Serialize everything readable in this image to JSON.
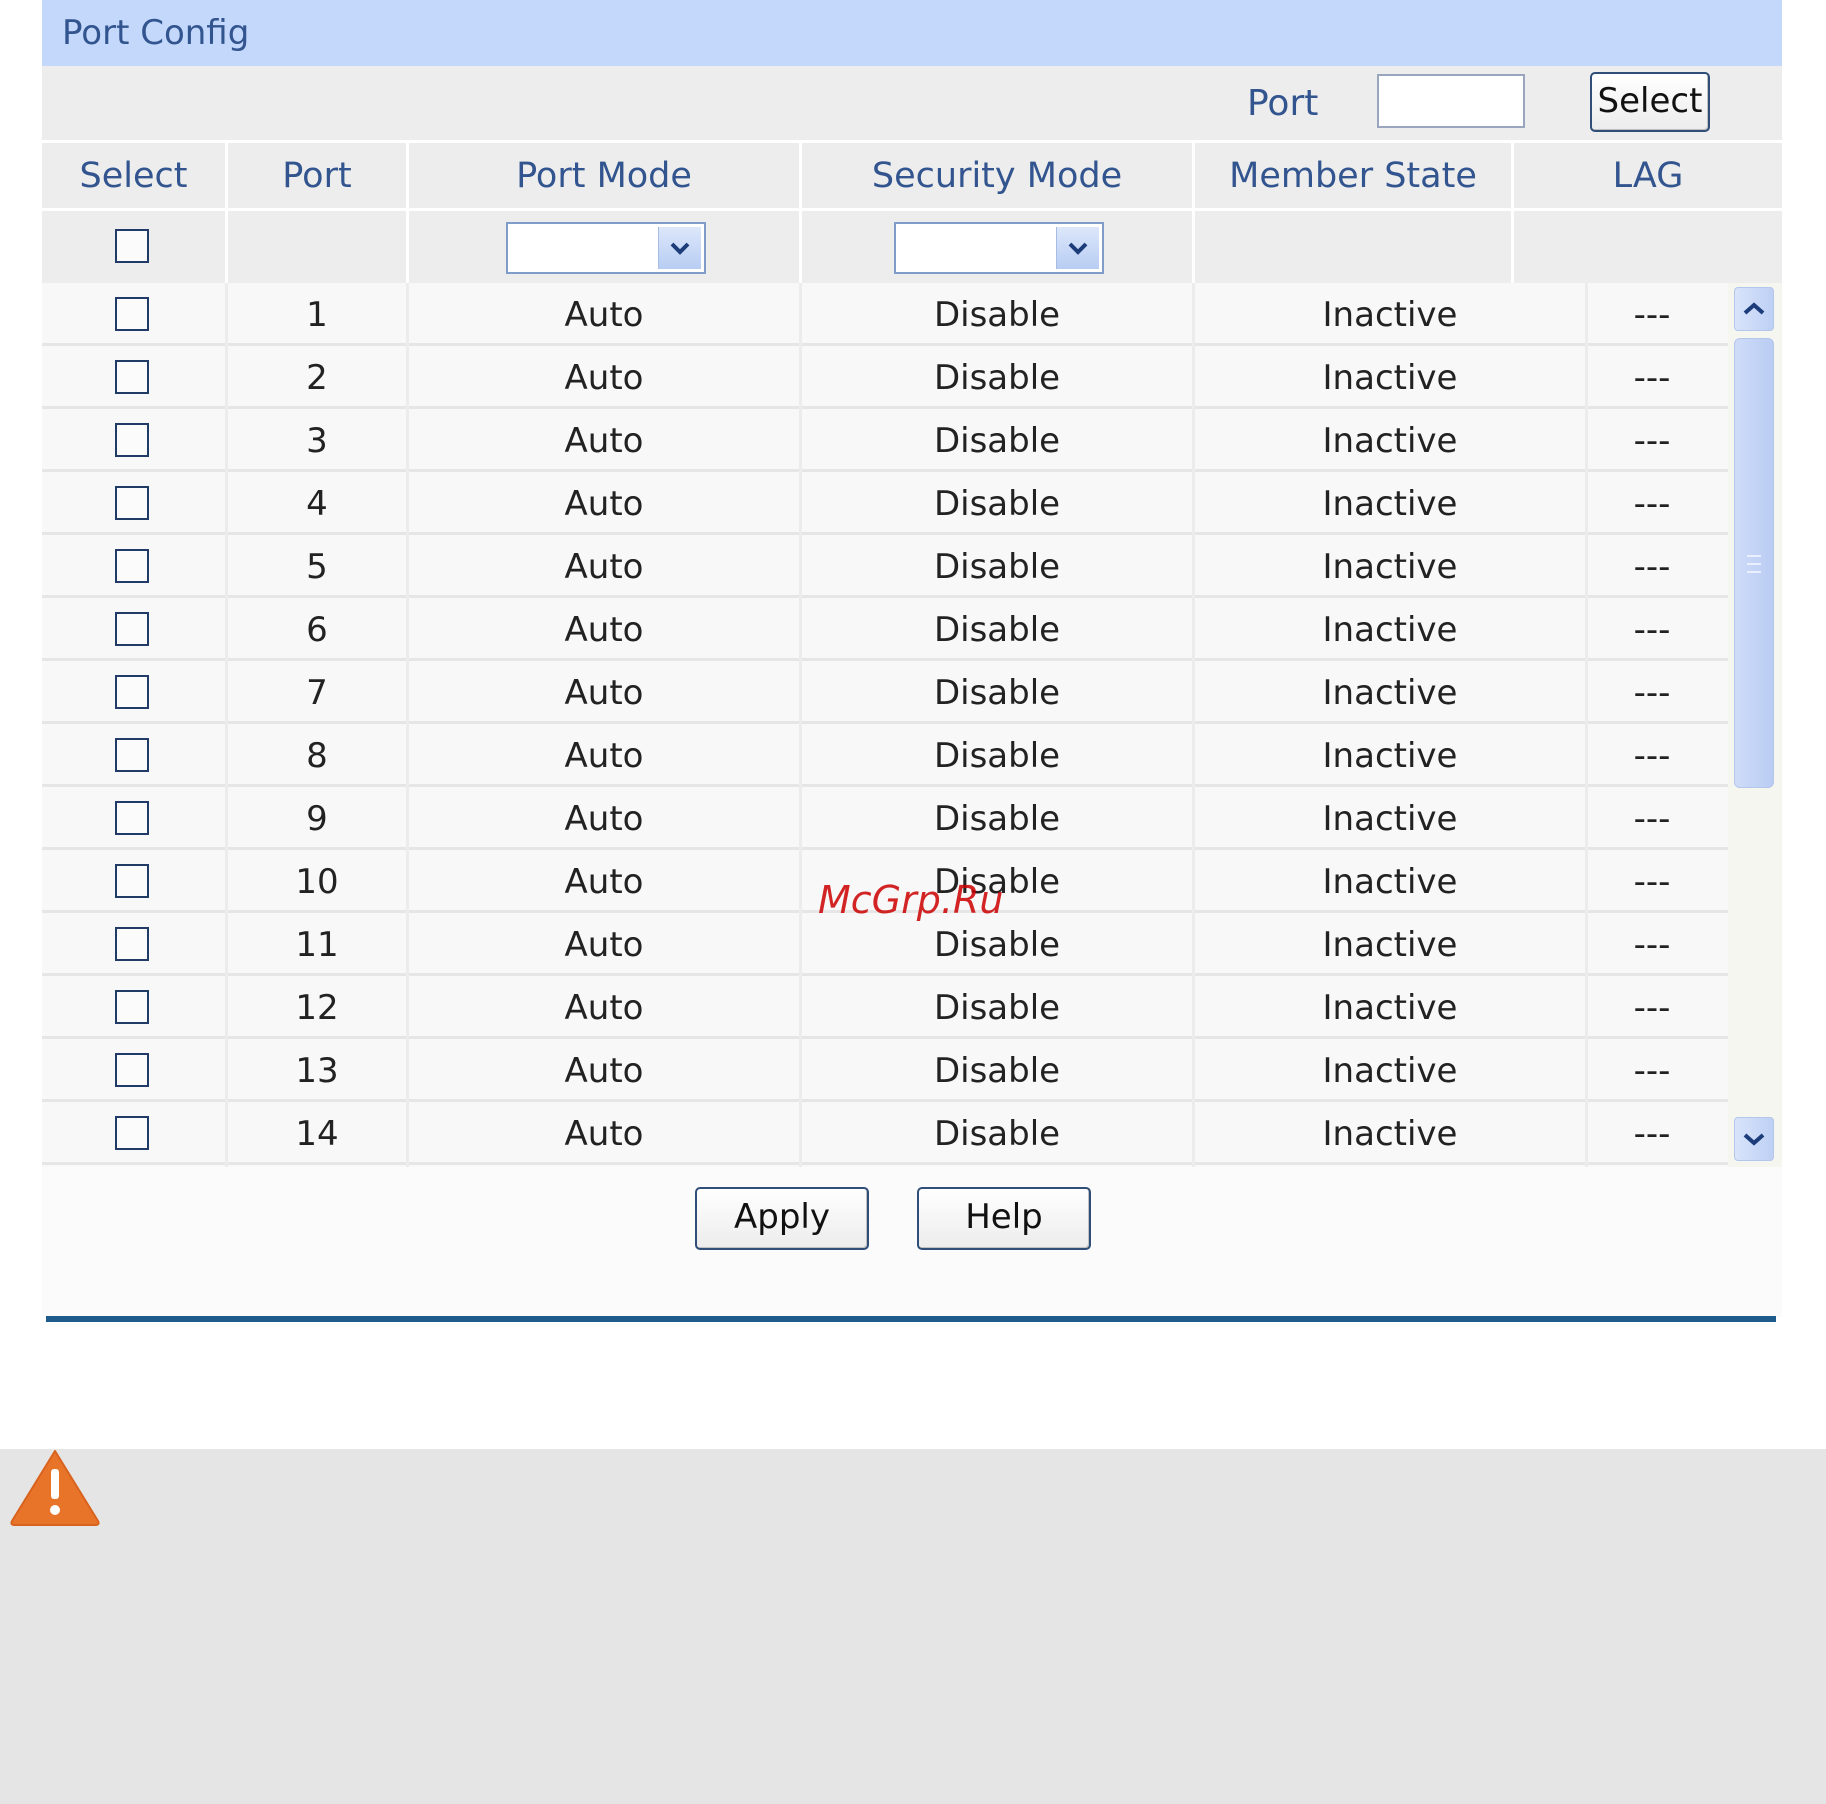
{
  "panel": {
    "title": "Port Config"
  },
  "toolbar": {
    "port_label": "Port",
    "port_value": "",
    "select_button": "Select"
  },
  "columns": [
    "Select",
    "Port",
    "Port Mode",
    "Security Mode",
    "Member State",
    "LAG"
  ],
  "filters": {
    "port_mode": "",
    "security_mode": ""
  },
  "rows": [
    {
      "port": "1",
      "mode": "Auto",
      "security": "Disable",
      "state": "Inactive",
      "lag": "---"
    },
    {
      "port": "2",
      "mode": "Auto",
      "security": "Disable",
      "state": "Inactive",
      "lag": "---"
    },
    {
      "port": "3",
      "mode": "Auto",
      "security": "Disable",
      "state": "Inactive",
      "lag": "---"
    },
    {
      "port": "4",
      "mode": "Auto",
      "security": "Disable",
      "state": "Inactive",
      "lag": "---"
    },
    {
      "port": "5",
      "mode": "Auto",
      "security": "Disable",
      "state": "Inactive",
      "lag": "---"
    },
    {
      "port": "6",
      "mode": "Auto",
      "security": "Disable",
      "state": "Inactive",
      "lag": "---"
    },
    {
      "port": "7",
      "mode": "Auto",
      "security": "Disable",
      "state": "Inactive",
      "lag": "---"
    },
    {
      "port": "8",
      "mode": "Auto",
      "security": "Disable",
      "state": "Inactive",
      "lag": "---"
    },
    {
      "port": "9",
      "mode": "Auto",
      "security": "Disable",
      "state": "Inactive",
      "lag": "---"
    },
    {
      "port": "10",
      "mode": "Auto",
      "security": "Disable",
      "state": "Inactive",
      "lag": "---"
    },
    {
      "port": "11",
      "mode": "Auto",
      "security": "Disable",
      "state": "Inactive",
      "lag": "---"
    },
    {
      "port": "12",
      "mode": "Auto",
      "security": "Disable",
      "state": "Inactive",
      "lag": "---"
    },
    {
      "port": "13",
      "mode": "Auto",
      "security": "Disable",
      "state": "Inactive",
      "lag": "---"
    },
    {
      "port": "14",
      "mode": "Auto",
      "security": "Disable",
      "state": "Inactive",
      "lag": "---"
    }
  ],
  "actions": {
    "apply": "Apply",
    "help": "Help"
  },
  "watermark": "McGrp.Ru",
  "icons": {
    "warning": "warning-icon",
    "dropdown": "chevron-down-icon",
    "scroll_up": "chevron-up-icon",
    "scroll_down": "chevron-down-icon"
  },
  "colors": {
    "title_bar": "#c4d8fb",
    "label_text": "#33558f",
    "divider": "#1e5a8a",
    "warning": "#e8742a"
  }
}
